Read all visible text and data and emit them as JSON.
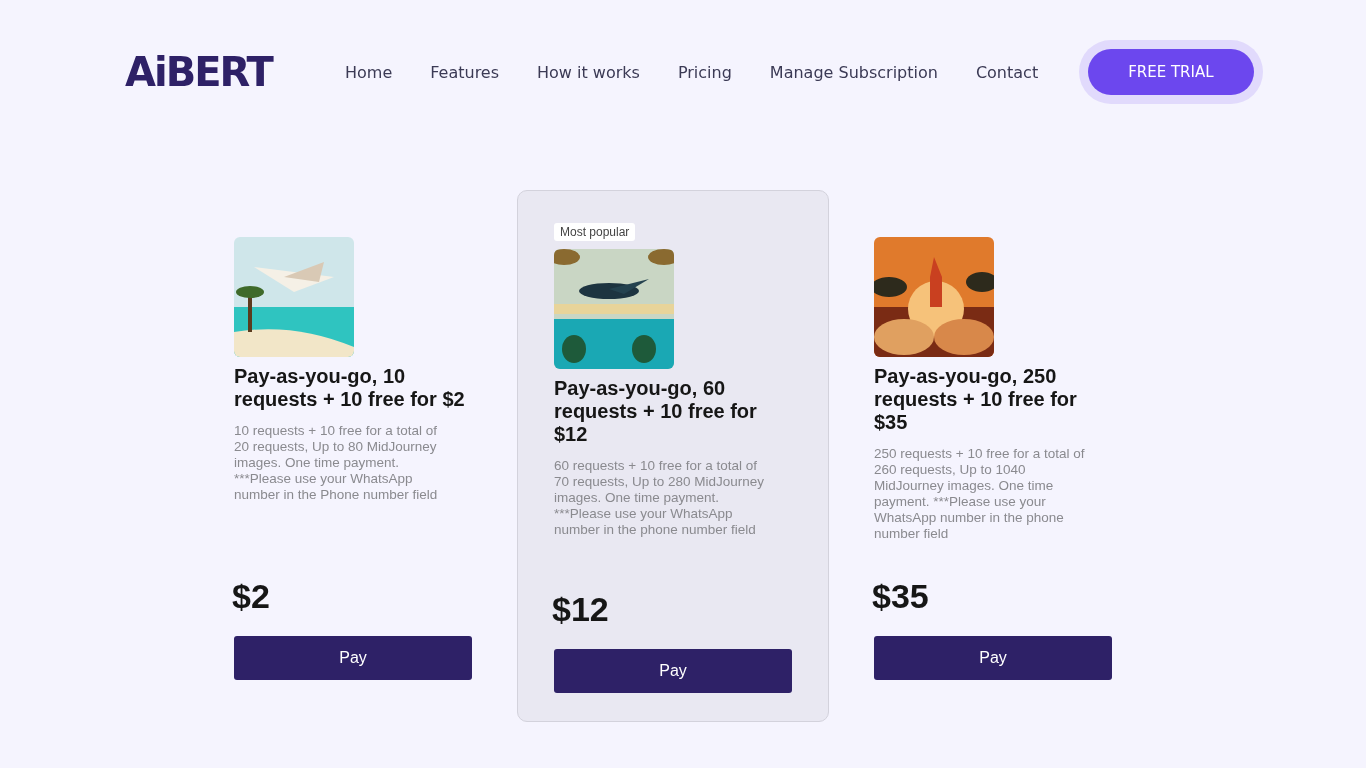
{
  "logo": {
    "text": "AiBERT"
  },
  "nav": {
    "links": [
      "Home",
      "Features",
      "How it works",
      "Pricing",
      "Manage Subscription",
      "Contact"
    ],
    "cta": "FREE TRIAL"
  },
  "plans": [
    {
      "title": "Pay-as-you-go, 10 requests + 10 free for $2",
      "description": "10 requests + 10 free for a total of 20 requests, Up to 80 MidJourney images. One time payment. ***Please use your WhatsApp number in the Phone number field",
      "price": "$2",
      "button": "Pay"
    },
    {
      "featured": true,
      "badge": "Most popular",
      "title": "Pay-as-you-go, 60 requests + 10 free for $12",
      "description": "60 requests + 10 free for a total of 70 requests, Up to 280 MidJourney images. One time payment. ***Please use your WhatsApp number in the phone number field",
      "price": "$12",
      "button": "Pay"
    },
    {
      "title": "Pay-as-you-go, 250 requests + 10 free for $35",
      "description": "250 requests + 10 free for a total of 260 requests, Up to 1040 MidJourney images. One time payment. ***Please use your WhatsApp number in the phone number field",
      "price": "$35",
      "button": "Pay"
    }
  ]
}
